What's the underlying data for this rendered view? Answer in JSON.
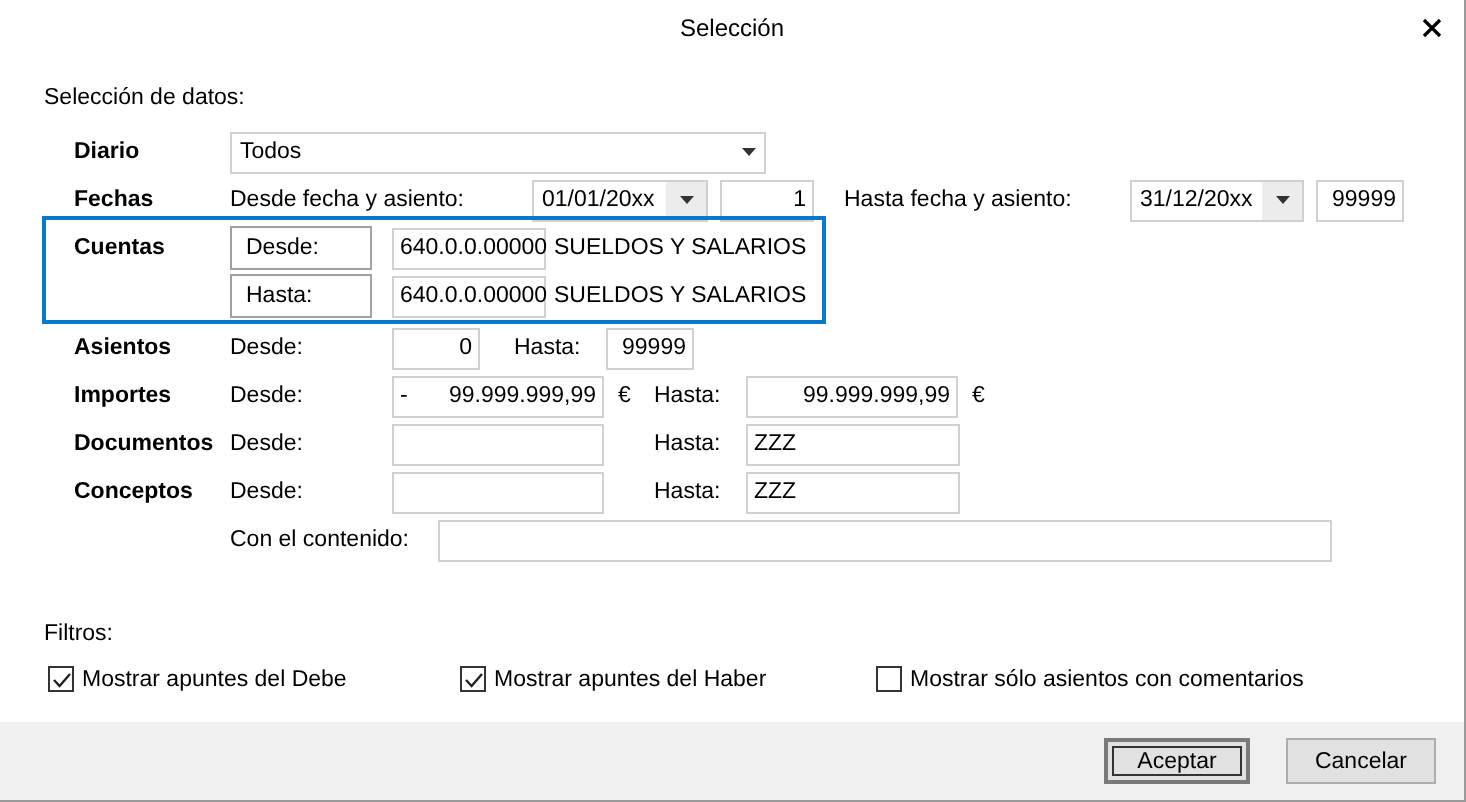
{
  "window": {
    "title": "Selección"
  },
  "section_label": "Selección de datos:",
  "diario": {
    "label": "Diario",
    "value": "Todos"
  },
  "fechas": {
    "label": "Fechas",
    "from_label": "Desde fecha y asiento:",
    "from_date": "01/01/20xx",
    "from_entry": "1",
    "to_label": "Hasta fecha y asiento:",
    "to_date": "31/12/20xx",
    "to_entry": "99999"
  },
  "cuentas": {
    "label": "Cuentas",
    "highlighted": true,
    "rows": [
      {
        "button": "Desde:",
        "code": "640.0.0.00000",
        "name": "SUELDOS Y SALARIOS"
      },
      {
        "button": "Hasta:",
        "code": "640.0.0.00000",
        "name": "SUELDOS Y SALARIOS"
      }
    ]
  },
  "ranges": [
    {
      "kind": "short",
      "label": "Asientos",
      "from_label": "Desde:",
      "from": "0",
      "to_label": "Hasta:",
      "to": "99999"
    },
    {
      "kind": "amount",
      "label": "Importes",
      "from_label": "Desde:",
      "from_sign": "-",
      "from": "99.999.999,99",
      "from_unit": "€",
      "to_label": "Hasta:",
      "to": "99.999.999,99",
      "to_unit": "€"
    },
    {
      "kind": "text",
      "label": "Documentos",
      "from_label": "Desde:",
      "to_label": "Hasta:",
      "to": "ZZZ"
    },
    {
      "kind": "text",
      "label": "Conceptos",
      "from_label": "Desde:",
      "to_label": "Hasta:",
      "to": "ZZZ"
    }
  ],
  "content": {
    "label": "Con el contenido:"
  },
  "filters": {
    "label": "Filtros:",
    "options": [
      {
        "label": "Mostrar apuntes del Debe",
        "checked": true
      },
      {
        "label": "Mostrar apuntes del Haber",
        "checked": true
      },
      {
        "label": "Mostrar sólo asientos con comentarios",
        "checked": false
      }
    ]
  },
  "buttons": [
    {
      "label": "Aceptar",
      "default": true
    },
    {
      "label": "Cancelar",
      "default": false
    }
  ]
}
